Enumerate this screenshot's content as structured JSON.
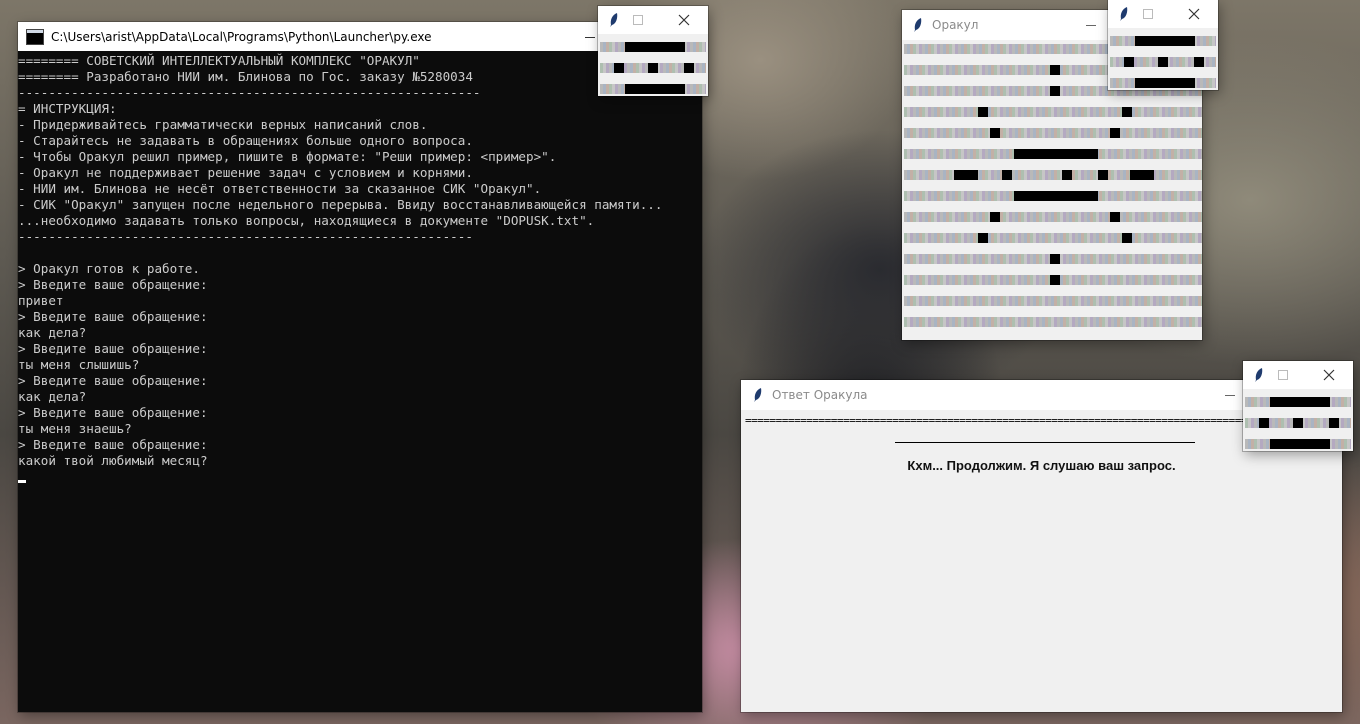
{
  "console": {
    "title": "C:\\Users\\arist\\AppData\\Local\\Programs\\Python\\Launcher\\py.exe",
    "lines": [
      "======== СОВЕТСКИЙ ИНТЕЛЛЕКТУАЛЬНЫЙ КОМПЛЕКС \"ОРАКУЛ\"",
      "======== Разработано НИИ им. Блинова по Гос. заказу №5280034",
      "-------------------------------------------------------------",
      "= ИНСТРУКЦИЯ:",
      "- Придерживайтесь грамматически верных написаний слов.",
      "- Старайтесь не задавать в обращениях больше одного вопроса.",
      "- Чтобы Оракул решил пример, пишите в формате: \"Реши пример: <пример>\".",
      "- Оракул не поддерживает решение задач с условием и корнями.",
      "- НИИ им. Блинова не несёт ответственности за сказанное СИК \"Оракул\".",
      "- СИК \"Оракул\" запущен после недельного перерыва. Ввиду восстанавливающейся памяти...",
      "...необходимо задавать только вопросы, находящиеся в документе \"DOPUSK.txt\".",
      "------------------------------------------------------------",
      "",
      "> Оракул готов к работе.",
      "> Введите ваше обращение:",
      "привет",
      "> Введите ваше обращение:",
      "как дела?",
      "> Введите ваше обращение:",
      "ты меня слышишь?",
      "> Введите ваше обращение:",
      "как дела?",
      "> Введите ваше обращение:",
      "ты меня знаешь?",
      "> Введите ваше обращение:",
      "какой твой любимый месяц?"
    ]
  },
  "oracle_window": {
    "title": "Оракул"
  },
  "answer_window": {
    "title": "Ответ Оракула",
    "rule": "==================================================================================================",
    "answer": "Кхм... Продолжим. Я слушаю ваш запрос."
  },
  "icons": {
    "app_icon": "tk-feather-icon",
    "console_icon": "cmd-icon",
    "minimize": "minimize-icon",
    "maximize": "maximize-icon",
    "close": "close-icon"
  },
  "colors": {
    "console_bg": "#0c0c0c",
    "console_text": "#cccccc",
    "window_bg": "#f0f0f0",
    "face_pixel": "#000000"
  }
}
